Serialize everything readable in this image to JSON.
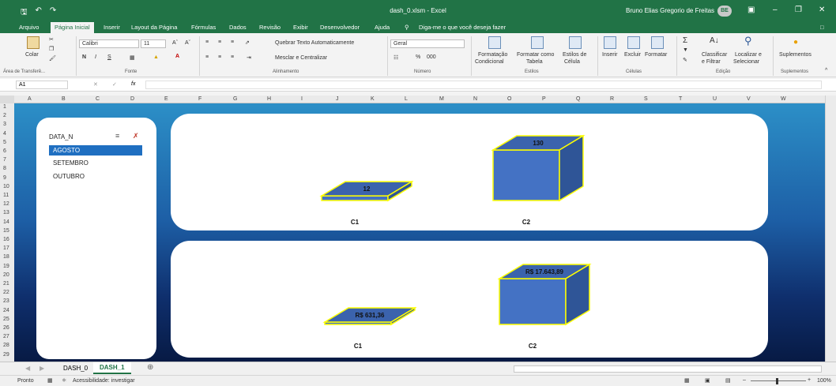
{
  "window": {
    "title": "dash_0.xlsm  -  Excel",
    "user": "Bruno Elias Gregorio de Freitas",
    "avatar_initials": "BE"
  },
  "menu": [
    "Arquivo",
    "Página Inicial",
    "Inserir",
    "Layout da Página",
    "Fórmulas",
    "Dados",
    "Revisão",
    "Exibir",
    "Desenvolvedor",
    "Ajuda"
  ],
  "tellme": "Diga-me o que você deseja fazer",
  "ribbon": {
    "clipboard_paste": "Colar",
    "clipboard_group": "Área de Transferê...",
    "font_name": "Calibri",
    "font_size": "11",
    "font_group": "Fonte",
    "bold": "N",
    "italic": "I",
    "underline": "S",
    "wrap_text": "Quebrar Texto Automaticamente",
    "merge_center": "Mesclar e Centralizar",
    "alignment_group": "Alinhamento",
    "number_format": "Geral",
    "number_group": "Número",
    "cond_format_1": "Formatação",
    "cond_format_2": "Condicional",
    "format_table_1": "Formatar como",
    "format_table_2": "Tabela",
    "cell_styles_1": "Estilos de",
    "cell_styles_2": "Célula",
    "styles_group": "Estilos",
    "insert": "Inserir",
    "delete": "Excluir",
    "format": "Formatar",
    "cells_group": "Células",
    "sort_filter_1": "Classificar",
    "sort_filter_2": "e Filtrar",
    "find_select_1": "Localizar e",
    "find_select_2": "Selecionar",
    "editing_group": "Edição",
    "addins": "Suplementos",
    "addins_group": "Suplementos"
  },
  "formula_bar": {
    "name_box": "A1",
    "fx": "fx",
    "content": ""
  },
  "columns": [
    "A",
    "B",
    "C",
    "D",
    "E",
    "F",
    "G",
    "H",
    "I",
    "J",
    "K",
    "L",
    "M",
    "N",
    "O",
    "P",
    "Q",
    "R",
    "S",
    "T",
    "U",
    "V",
    "W"
  ],
  "rows": [
    "1",
    "2",
    "3",
    "4",
    "5",
    "6",
    "7",
    "8",
    "9",
    "10",
    "11",
    "12",
    "13",
    "14",
    "15",
    "16",
    "17",
    "18",
    "19",
    "20",
    "21",
    "22",
    "23",
    "24",
    "25",
    "26",
    "27",
    "28",
    "29"
  ],
  "slicer": {
    "title": "DATA_N",
    "items": [
      "AGOSTO",
      "SETEMBRO",
      "OUTUBRO"
    ],
    "selected": 0,
    "accent": "#1f6fc1"
  },
  "chart_data": [
    {
      "type": "bar",
      "categories": [
        "C1",
        "C2"
      ],
      "values": [
        12,
        130
      ],
      "data_labels": [
        "12",
        "130"
      ],
      "style": "3d-box",
      "fill": "#4472c4",
      "border": "#ffff00"
    },
    {
      "type": "bar",
      "categories": [
        "C1",
        "C2"
      ],
      "values": [
        631.36,
        17643.89
      ],
      "data_labels": [
        "R$ 631,36",
        "R$ 17.643,89"
      ],
      "style": "3d-box",
      "fill": "#4472c4",
      "border": "#ffff00"
    }
  ],
  "sheet_tabs": [
    "DASH_0",
    "DASH_1"
  ],
  "active_tab": "DASH_1",
  "status": {
    "ready": "Pronto",
    "accessibility": "Acessibilidade: investigar",
    "zoom": "100%"
  }
}
